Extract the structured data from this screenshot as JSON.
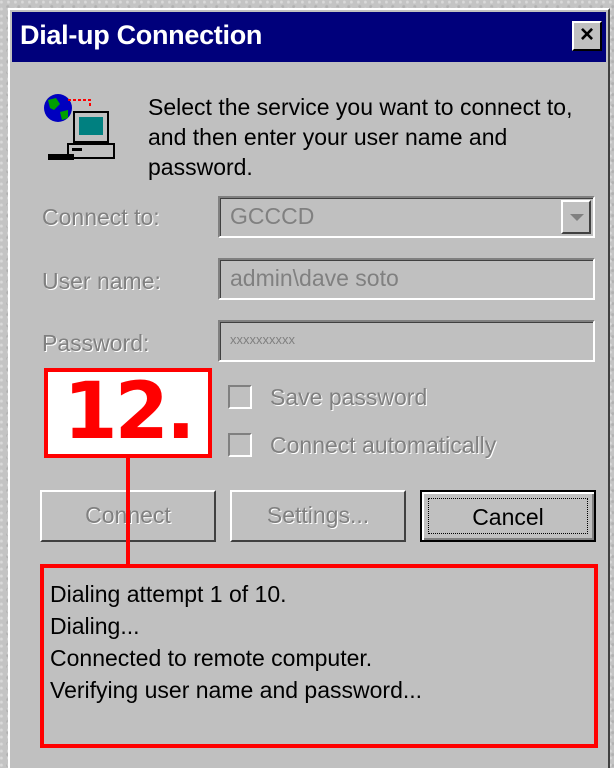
{
  "window": {
    "title": "Dial-up Connection",
    "close_label": "×"
  },
  "intro": {
    "text": "Select the service you want to connect to, and then enter your user name and password."
  },
  "form": {
    "connect_to": {
      "label": "Connect to:",
      "value": "GCCCD"
    },
    "user_name": {
      "label": "User name:",
      "value": "admin\\dave soto"
    },
    "password": {
      "label": "Password:",
      "value": "xxxxxxxxxx"
    },
    "save_password": {
      "label": "Save password",
      "checked": false
    },
    "connect_automatically": {
      "label": "Connect automatically",
      "checked": false
    }
  },
  "buttons": {
    "connect": "Connect",
    "settings": "Settings...",
    "cancel": "Cancel"
  },
  "status": {
    "lines": [
      "Dialing attempt 1 of 10.",
      "Dialing...",
      "Connected to remote computer.",
      "Verifying user name and password..."
    ]
  },
  "callout": {
    "label": "12."
  },
  "colors": {
    "titlebar": "#00007b",
    "dialog": "#c0c0c0",
    "annotation": "#ff0000",
    "disabled_text": "#808080"
  },
  "icons": {
    "connection": "globe-computer-icon",
    "dropdown": "chevron-down-icon",
    "close": "close-icon"
  }
}
